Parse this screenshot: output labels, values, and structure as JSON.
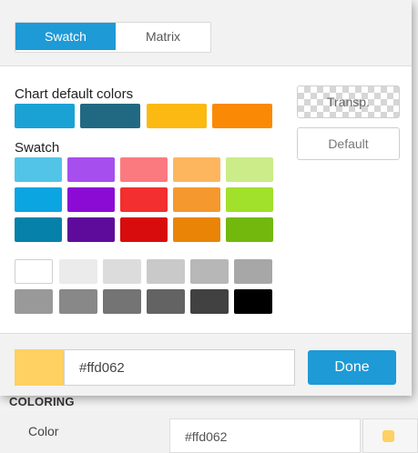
{
  "tabs": [
    {
      "label": "Swatch",
      "active": true
    },
    {
      "label": "Matrix",
      "active": false
    }
  ],
  "chart_defaults": {
    "title": "Chart default colors",
    "colors": [
      "#1aa2d5",
      "#216983",
      "#fbb911",
      "#fa8a05"
    ]
  },
  "swatch": {
    "title": "Swatch",
    "rows": [
      [
        "#52c4e8",
        "#a64fee",
        "#fb7a80",
        "#fdb65e",
        "#cbec88"
      ],
      [
        "#0ba5e1",
        "#8c0bd4",
        "#f32f2f",
        "#f5982e",
        "#a1e02b"
      ],
      [
        "#0581aa",
        "#5e0b9b",
        "#d80c0c",
        "#ea8407",
        "#73b80c"
      ]
    ]
  },
  "grays": {
    "rows": [
      [
        "#ffffff",
        "#ebebeb",
        "#dcdcdc",
        "#c9c9c9",
        "#b7b7b7",
        "#a7a7a7"
      ],
      [
        "#999999",
        "#888888",
        "#747474",
        "#636363",
        "#414141",
        "#000000"
      ]
    ]
  },
  "side_buttons": {
    "transparent_label": "Transp.",
    "default_label": "Default"
  },
  "footer": {
    "preview_color": "#ffd062",
    "hex_value": "#ffd062",
    "done_label": "Done"
  },
  "underlying": {
    "section_label": "COLORING",
    "row_label": "Color",
    "value": "#ffd062",
    "swatch_color": "#ffd062"
  }
}
